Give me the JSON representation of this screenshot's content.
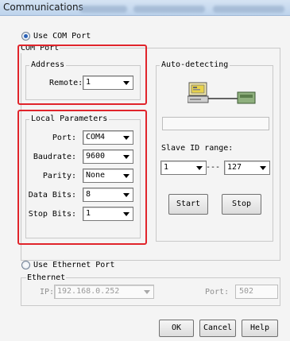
{
  "window": {
    "title": "Communications"
  },
  "com_port": {
    "radio_label": "Use COM Port",
    "group_title": "COM Port",
    "address": {
      "group_title": "Address",
      "remote_label": "Remote:",
      "remote_value": "1"
    },
    "local": {
      "group_title": "Local Parameters",
      "fields": [
        {
          "label": "Port:",
          "value": "COM4"
        },
        {
          "label": "Baudrate:",
          "value": "9600"
        },
        {
          "label": "Parity:",
          "value": "None"
        },
        {
          "label": "Data Bits:",
          "value": "8"
        },
        {
          "label": "Stop Bits:",
          "value": "1"
        }
      ]
    }
  },
  "auto_detect": {
    "group_title": "Auto-detecting",
    "slave_range_label": "Slave ID range:",
    "range_from": "1",
    "range_separator": "---",
    "range_to": "127",
    "start_label": "Start",
    "stop_label": "Stop"
  },
  "ethernet": {
    "radio_label": "Use Ethernet Port",
    "group_title": "Ethernet",
    "ip_label": "IP:",
    "ip_value": "192.168.0.252",
    "port_label": "Port:",
    "port_value": "502"
  },
  "buttons": {
    "ok": "OK",
    "cancel": "Cancel",
    "help": "Help"
  },
  "colors": {
    "highlight": "#e0242b",
    "title_bar": "#c8dbf0",
    "selected_radio": "#2a62b8"
  }
}
